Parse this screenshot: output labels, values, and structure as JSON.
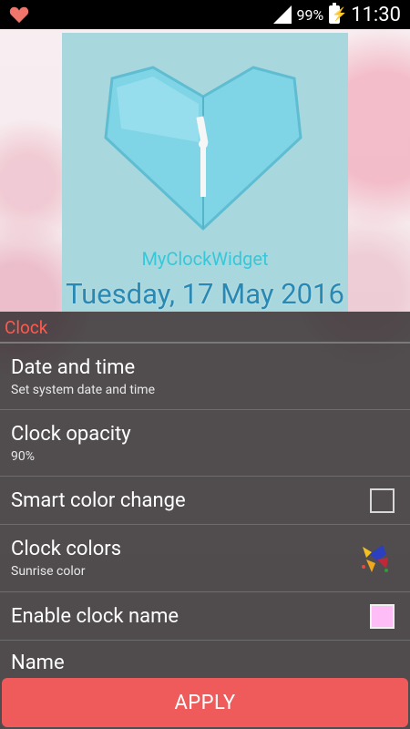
{
  "status_bar": {
    "battery_percent": "99%",
    "time": "11:30"
  },
  "preview": {
    "clock_name": "MyClockWidget",
    "date": "Tuesday, 17 May 2016"
  },
  "settings": {
    "category": "Clock",
    "items": [
      {
        "title": "Date and time",
        "subtitle": "Set system date and time"
      },
      {
        "title": "Clock opacity",
        "subtitle": "90%"
      },
      {
        "title": "Smart color change",
        "checked": false
      },
      {
        "title": "Clock colors",
        "subtitle": "Sunrise color"
      },
      {
        "title": "Enable clock name",
        "checkbox_color": "#ffbdf7"
      },
      {
        "title": "Name"
      }
    ]
  },
  "apply_label": "APPLY",
  "colors": {
    "accent": "#ff5a4d",
    "apply_button": "#ef5b5b",
    "heart": "#7fd4e6",
    "preview_bg": "#a9d7de"
  }
}
